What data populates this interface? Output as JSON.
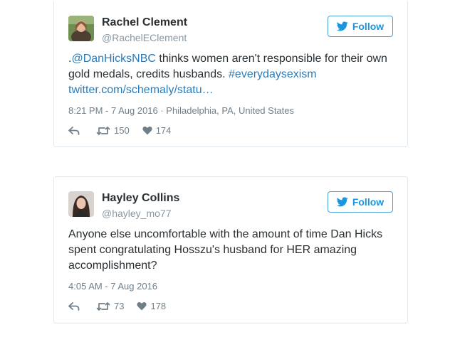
{
  "tweets": [
    {
      "name": "Rachel Clement",
      "handle": "@RachelEClement",
      "follow_label": "Follow",
      "text": {
        "prefix": ".",
        "mention": "@DanHicksNBC",
        "middle": " thinks women aren't responsible for their own gold medals, credits husbands. ",
        "hashtag": "#everydaysexism",
        "link": "twitter.com/schemaly/statu…"
      },
      "timestamp": "8:21 PM - 7 Aug 2016 · Philadelphia, PA, United States",
      "retweets": "150",
      "likes": "174"
    },
    {
      "name": "Hayley Collins",
      "handle": "@hayley_mo77",
      "follow_label": "Follow",
      "text": "Anyone else uncomfortable with the amount of time Dan Hicks spent congratulating Hosszu's husband for HER amazing accomplishment?",
      "timestamp": "4:05 AM - 7 Aug 2016",
      "retweets": "73",
      "likes": "178"
    }
  ],
  "colors": {
    "accent": "#1b95e0",
    "link": "#2b7bb9",
    "muted": "#707e88",
    "border": "#e1e8ed"
  }
}
